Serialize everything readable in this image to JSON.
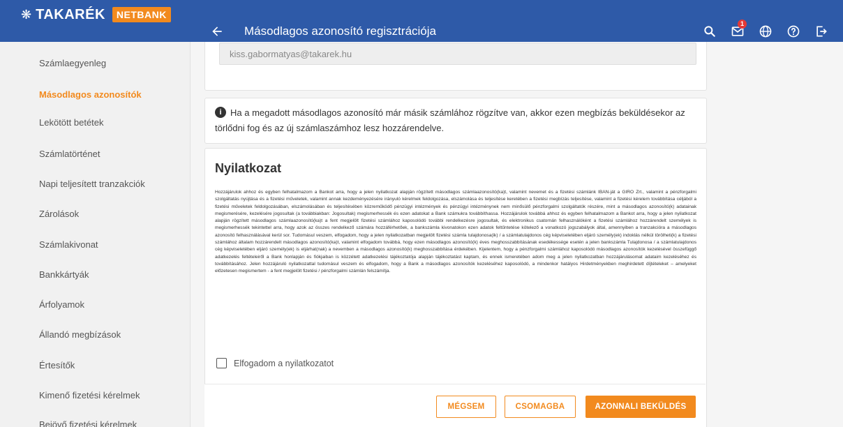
{
  "header": {
    "logo_mark": "❋",
    "logo_text": "TAKARÉK",
    "logo_badge": "NETBANK",
    "title": "Másodlagos azonosító regisztrációja",
    "notification_count": "1"
  },
  "sidebar": {
    "items": [
      {
        "label": "Számlaegyenleg"
      },
      {
        "label": "Másodlagos azonosítók"
      },
      {
        "label": "Lekötött betétek"
      },
      {
        "label": "Számlatörténet"
      },
      {
        "label": "Napi teljesített tranzakciók"
      },
      {
        "label": "Zárolások"
      },
      {
        "label": "Számlakivonat"
      },
      {
        "label": "Bankkártyák"
      },
      {
        "label": "Árfolyamok"
      },
      {
        "label": "Állandó megbízások"
      },
      {
        "label": "Értesítők"
      },
      {
        "label": "Kimenő fizetési kérelmek"
      },
      {
        "label": "Bejövő fizetési kérelmek"
      }
    ]
  },
  "email": {
    "value": "kiss.gabormatyas@takarek.hu"
  },
  "info": {
    "text": "Ha a megadott másodlagos azonosító már másik számlához rögzítve van, akkor ezen megbízás beküldésekor az törlődni fog és az új számlaszámhoz lesz hozzárendelve."
  },
  "declaration": {
    "title": "Nyilatkozat",
    "body": "Hozzájárulok ahhoz és egyben felhatalmazom a Bankot arra, hogy a jelen nyilatkozat alapján rögzített másodlagos számlaazonosító(ka)t, valamint nevemet és a fizetési számlánk IBAN-ját a GIRO Zrt., valamint a pénzforgalmi szolgáltatás nyújtása és a fizetési műveletek, valamint annak kezdeményezésére irányuló kérelmek feldolgozása, elszámolása és teljesítése keretében a fizetési megbízás teljesítése, valamint a fizetési kérelem továbbítása céljából a fizetési műveletek feldolgozásában, elszámolásában és teljesítésében közreműködő pénzügyi intézmények és pénzügyi intézménynek nem minősülő pénzforgalmi szolgáltatók részére, mint a másodlagos azonosító(k) adatainak megismerésére, kezelésére jogosultak (a továbbiakban: Jogosultak) megismerhessék és ezen adatokat a Bank számukra továbbíthassa. Hozzájárulok továbbá ahhoz és egyben felhatalmazom a Bankot arra, hogy a jelen nyilatkozat alapján rögzített másodlagos számlaazonosító(ka)t a fent megjelölt fizetési számlához kaposolódó további rendelkezésre jogosultak, és elektronikus csatornán felhasználóként a fizetési számlához hozzárendelt személyek is megismerhessék tekintettel arra, hogy azok az összes rendelkező számára hozzáférhetőek, a bankszámla kivonatokon ezen adatok feltűntetése kötelező a vonatkozó jogszabályok által, amennyiben a tranzakcióra a másodlagos azonosító felhasználásával kerül sor. Tudomásul veszem, elfogadom, hogy a jelen nyilatkozatban megjelölt fizetési számla tulajdonosa(ik) / a számlatulajdonos cég képviseletében eljáró személy(ek) indoklás nélkül törölheti(k) a fizetési számlához általam hozzárendelt másodlagos azonosító(ka)t, valamint elfogadom továbbá, hogy ezen másodlagos azonosító(k) éves meghosszabbításának esedékessége esetén a jelen bankszámla Tulajdonosa / a számlatulajdonos cég képviseletében eljáró személy(ek) is eljárhat(nak) a nevemben a másodlagos azonosító(k) meghosszabbítása érdekében. Kijelentem, hogy a pénzforgalmi számlához kaposolódó másodlagos azonosítók kezelésével összefüggő adatkezelés feltételeiről a Bank honlapján és fiókjaiban is közzétett adatkezelési tájékoztatója alapján tájékoztatást kaptam, és ennek ismeretében adom meg a jelen nyilatkozatban hozzájárulásomat adataim kezeléséhez és továbbításához. Jelen hozzájáruló nyilatkozattal tudomásul veszem és elfogadom, hogy a Bank a másodlagos azonosítók kezeléséhez kaposolódó, a mindenkor hatályos Hirdetményekben meghirdetett díjtételeket – amelyeket előzetesen megismertem - a fent megjelölt fizetési / pénzforgalmi számlán felszámítja.",
    "accept_label": "Elfogadom a nyilatkozatot"
  },
  "actions": {
    "cancel": "MÉGSEM",
    "package": "CSOMAGBA",
    "send_now": "AZONNALI BEKÜLDÉS"
  },
  "colors": {
    "header_bg": "#2e5aa8",
    "accent": "#f28a1e"
  }
}
